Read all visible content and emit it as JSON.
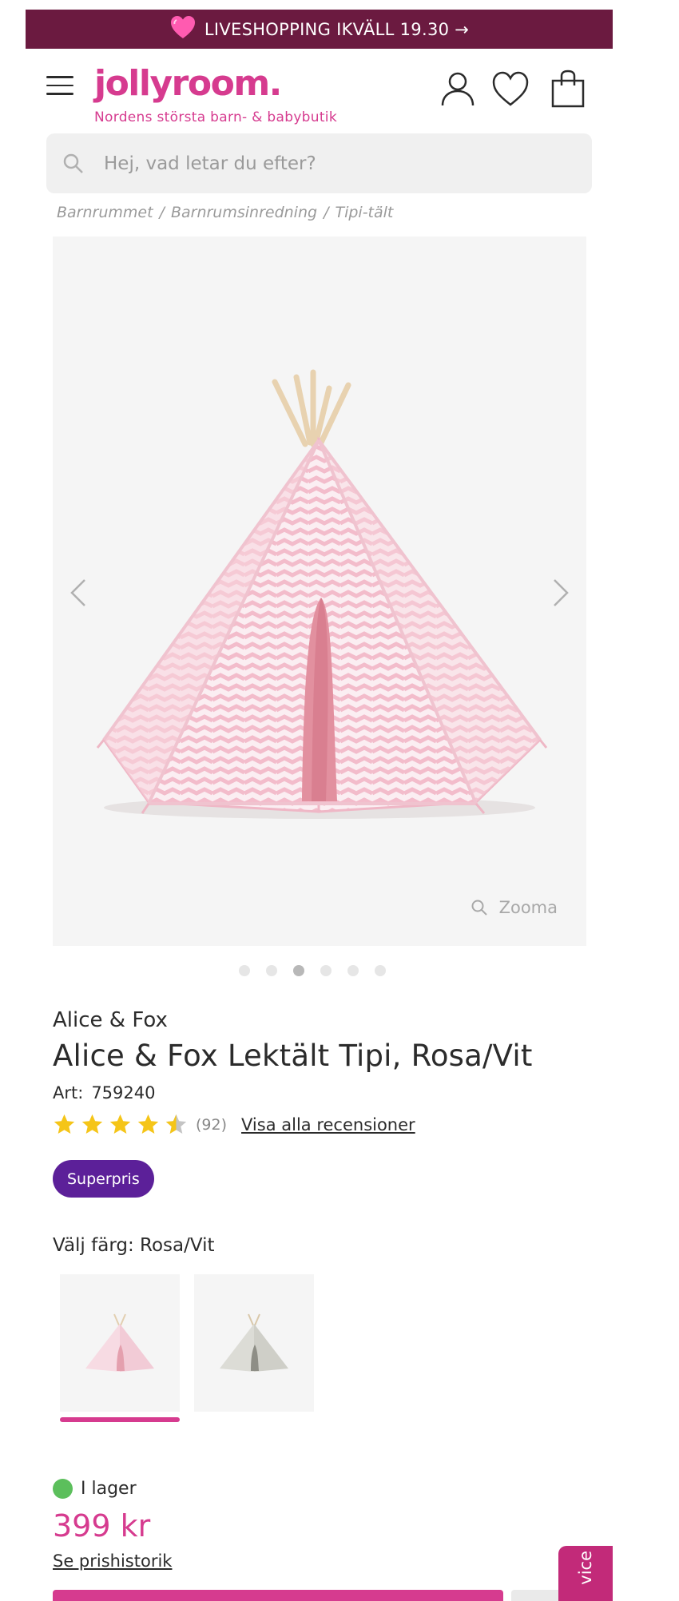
{
  "banner": {
    "text": "LIVESHOPPING IKVÄLL 19.30 →",
    "icon": "heart-emoji-icon"
  },
  "header": {
    "logo": "jollyroom.",
    "tagline": "Nordens största barn- & babybutik",
    "icons": [
      "menu-icon",
      "account-icon",
      "heart-icon",
      "shopping-bag-icon"
    ]
  },
  "search": {
    "placeholder": "Hej, vad letar du efter?"
  },
  "breadcrumb": [
    {
      "label": "Barnrummet"
    },
    {
      "label": "Barnrumsinredning"
    },
    {
      "label": "Tipi-tält"
    }
  ],
  "gallery": {
    "zoom_label": "Zooma",
    "total_images": 6,
    "active_index": 2
  },
  "product": {
    "brand": "Alice & Fox",
    "title": "Alice & Fox Lektält Tipi, Rosa/Vit",
    "art_label": "Art:",
    "art_number": "759240",
    "rating": 4.5,
    "rating_count": "(92)",
    "reviews_link": "Visa alla recensioner",
    "badge": "Superpris"
  },
  "color_picker": {
    "label": "Välj färg: Rosa/Vit",
    "options": [
      {
        "color": "#f4c9d3",
        "selected": true
      },
      {
        "color": "#d9d9d3",
        "selected": false
      }
    ]
  },
  "purchase": {
    "stock_label": "I lager",
    "stock_color": "#5cbf5c",
    "price": "399 kr",
    "price_history_link": "Se prishistorik"
  },
  "service_tab": {
    "label": "vice"
  },
  "colors": {
    "brand_pink": "#d63b8f",
    "banner_bg": "#6b1a40",
    "badge_purple": "#5c2099"
  }
}
